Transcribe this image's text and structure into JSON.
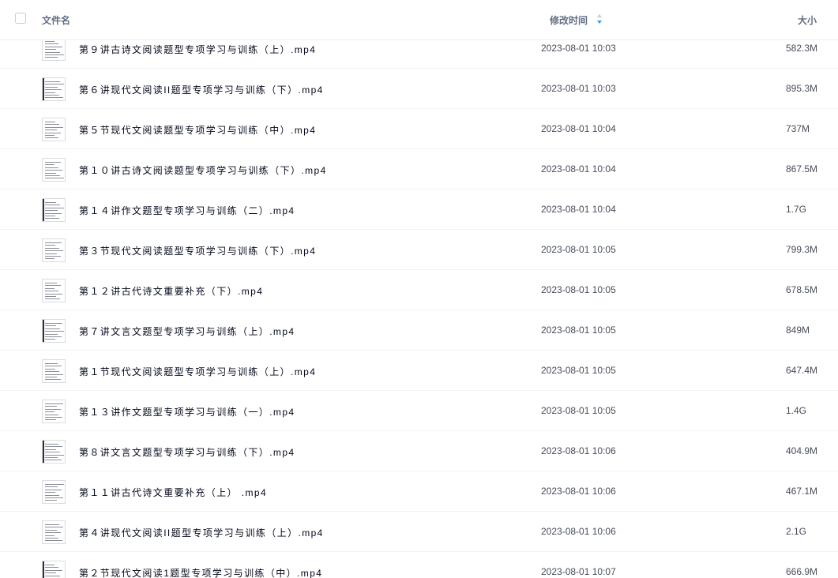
{
  "header": {
    "name_label": "文件名",
    "time_label": "修改时间",
    "size_label": "大小",
    "sort_color": "#06a7ff"
  },
  "files": [
    {
      "name": "第９讲古诗文阅读题型专项学习与训练（上）.mp4",
      "time": "2023-08-01 10:03",
      "size": "582.3M"
    },
    {
      "name": "第６讲现代文阅读II题型专项学习与训练（下）.mp4",
      "time": "2023-08-01 10:03",
      "size": "895.3M"
    },
    {
      "name": "第５节现代文阅读题型专项学习与训练（中）.mp4",
      "time": "2023-08-01 10:04",
      "size": "737M"
    },
    {
      "name": "第１０讲古诗文阅读题型专项学习与训练（下）.mp4",
      "time": "2023-08-01 10:04",
      "size": "867.5M"
    },
    {
      "name": "第１４讲作文题型专项学习与训练（二）.mp4",
      "time": "2023-08-01 10:04",
      "size": "1.7G"
    },
    {
      "name": "第３节现代文阅读题型专项学习与训练（下）.mp4",
      "time": "2023-08-01 10:05",
      "size": "799.3M"
    },
    {
      "name": "第１２讲古代诗文重要补充（下）.mp4",
      "time": "2023-08-01 10:05",
      "size": "678.5M"
    },
    {
      "name": "第７讲文言文题型专项学习与训练（上）.mp4",
      "time": "2023-08-01 10:05",
      "size": "849M"
    },
    {
      "name": "第１节现代文阅读题型专项学习与训练（上）.mp4",
      "time": "2023-08-01 10:05",
      "size": "647.4M"
    },
    {
      "name": "第１３讲作文题型专项学习与训练（一）.mp4",
      "time": "2023-08-01 10:05",
      "size": "1.4G"
    },
    {
      "name": "第８讲文言文题型专项学习与训练（下）.mp4",
      "time": "2023-08-01 10:06",
      "size": "404.9M"
    },
    {
      "name": "第１１讲古代诗文重要补充（上） .mp4",
      "time": "2023-08-01 10:06",
      "size": "467.1M"
    },
    {
      "name": "第４讲现代文阅读II题型专项学习与训练（上）.mp4",
      "time": "2023-08-01 10:06",
      "size": "2.1G"
    },
    {
      "name": "第２节现代文阅读1题型专项学习与训练（中）.mp4",
      "time": "2023-08-01 10:07",
      "size": "666.9M"
    }
  ]
}
